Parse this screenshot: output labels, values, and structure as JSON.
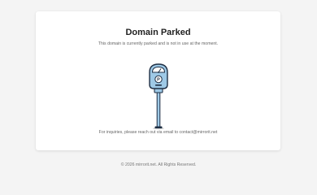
{
  "card": {
    "title": "Domain Parked",
    "subtitle": "This domain is currently parked and is not in use at the moment.",
    "illustration": "parking-meter-icon",
    "contact_text": "For inquiries, please reach out via email to contact@mirrorit.net"
  },
  "footer": {
    "text": "© 2026 mirrorit.net. All Rights Reserved."
  },
  "colors": {
    "background": "#f4f4f4",
    "card": "#ffffff",
    "meter_dark": "#1f2f44",
    "meter_light": "#9ec9e6"
  }
}
